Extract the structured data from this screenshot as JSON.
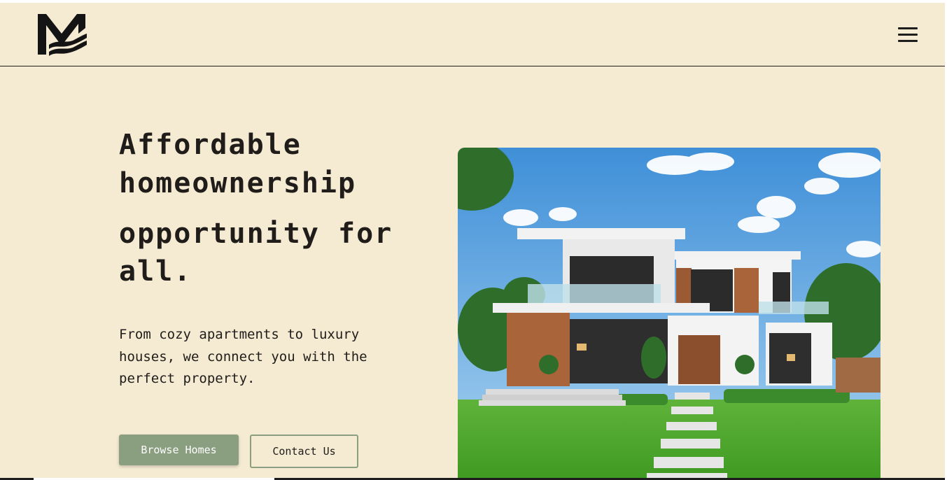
{
  "header": {
    "logo_text": "M",
    "logo_icon": "wave-m-logo-icon",
    "menu_icon": "hamburger-menu-icon"
  },
  "hero": {
    "headline_line1": "Affordable",
    "headline_line2": "homeownership",
    "headline_line3": "opportunity for",
    "headline_line4": "all.",
    "subtitle": "From cozy apartments to luxury houses, we connect you with the perfect property.",
    "primary_button": "Browse Homes",
    "secondary_button": "Contact Us",
    "image_icon": "modern-house-image"
  },
  "colors": {
    "background": "#f5ead2",
    "accent": "#8a9e80",
    "text": "#1f1c1a"
  }
}
